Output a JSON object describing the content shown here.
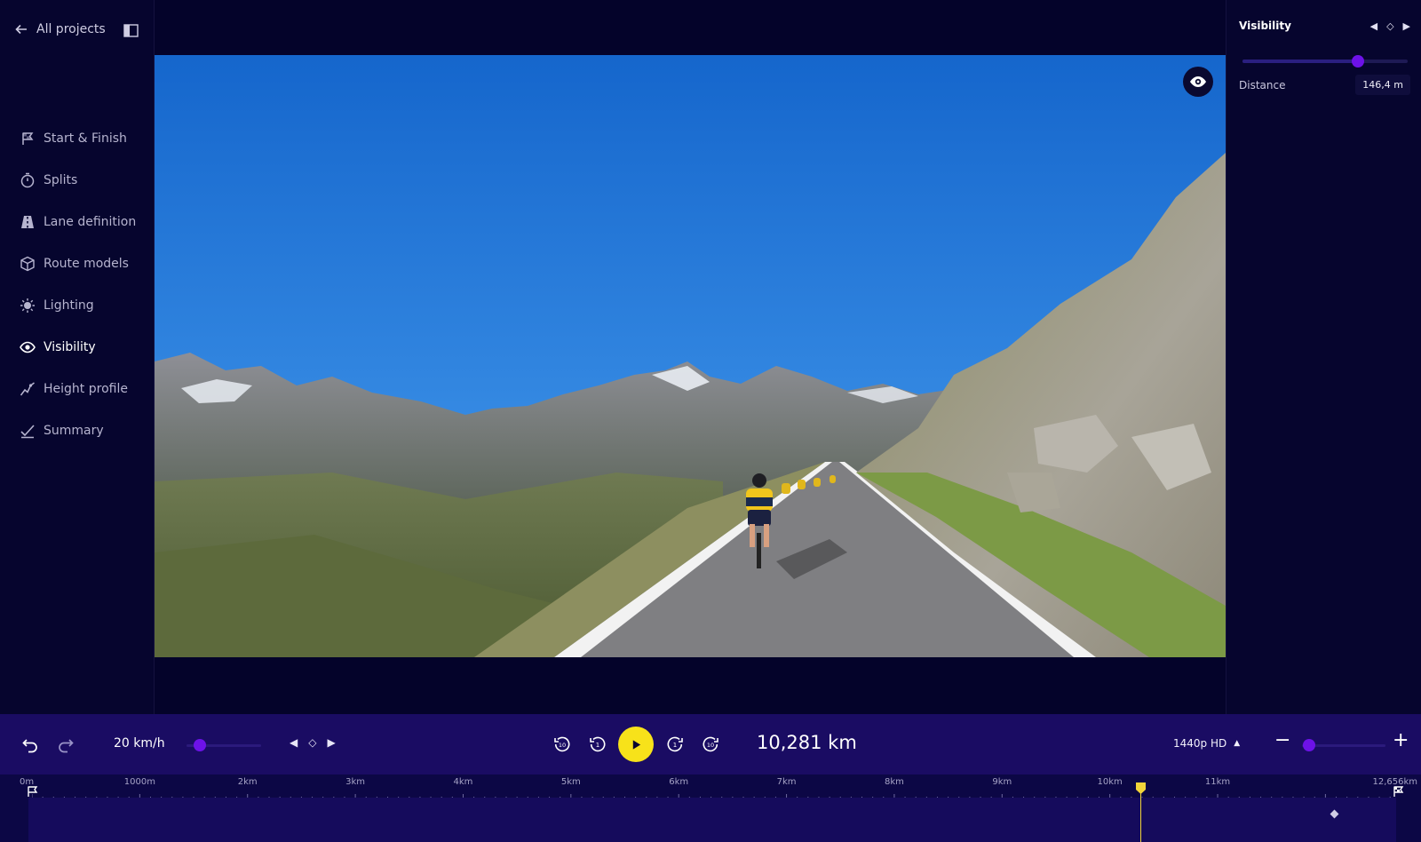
{
  "nav_back": {
    "label": "All projects",
    "icon": "arrow-left-icon"
  },
  "sidebar": {
    "items": [
      {
        "label": "Start & Finish",
        "icon": "flag-icon",
        "active": false
      },
      {
        "label": "Splits",
        "icon": "stopwatch-icon",
        "active": false
      },
      {
        "label": "Lane definition",
        "icon": "road-icon",
        "active": false
      },
      {
        "label": "Route models",
        "icon": "cube-icon",
        "active": false
      },
      {
        "label": "Lighting",
        "icon": "sun-icon",
        "active": false
      },
      {
        "label": "Visibility",
        "icon": "eye-icon",
        "active": true
      },
      {
        "label": "Height profile",
        "icon": "height-profile-icon",
        "active": false
      },
      {
        "label": "Summary",
        "icon": "checkmark-icon",
        "active": false
      }
    ]
  },
  "right_panel": {
    "title": "Visibility",
    "slider_level": 0.7,
    "distance_label": "Distance",
    "distance_value": "146,4 m"
  },
  "transport": {
    "speed": "20 km/h",
    "speed_slider_level": 0.18,
    "distance": "10,281 km",
    "quality": "1440p HD",
    "zoom_level": 0.08
  },
  "timeline": {
    "ticks": [
      "0m",
      "1000m",
      "2km",
      "3km",
      "4km",
      "5km",
      "6km",
      "7km",
      "8km",
      "9km",
      "10km",
      "11km",
      "12,656km"
    ],
    "playhead_km": 10.281,
    "total_km": 12.656
  },
  "colors": {
    "background": "#04032a",
    "accent": "#6d12e8",
    "play": "#f7e21a",
    "transport": "#1a0c63"
  }
}
